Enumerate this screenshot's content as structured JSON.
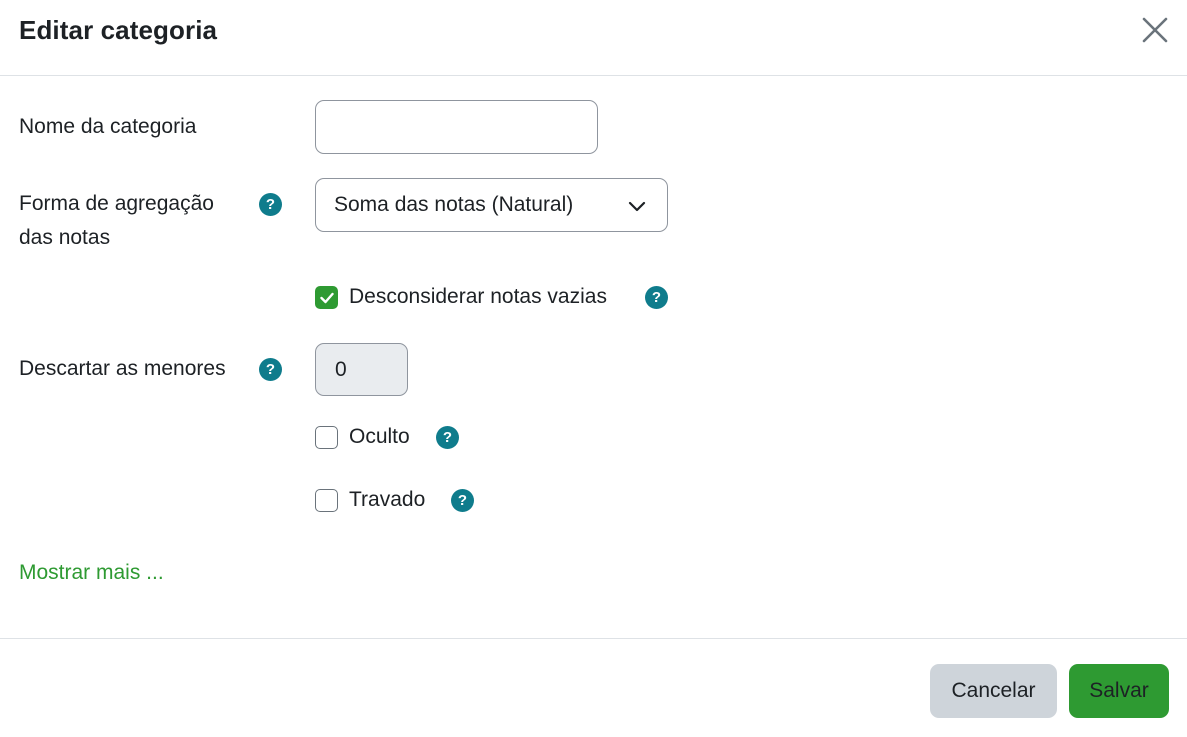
{
  "modal": {
    "title": "Editar categoria",
    "close_label": "close-icon"
  },
  "form": {
    "category_name": {
      "label": "Nome da categoria",
      "value": "",
      "placeholder": ""
    },
    "aggregation": {
      "label_line1": "Forma de agregação",
      "label_line2": "das notas",
      "selected": "Soma das notas (Natural)",
      "help_icon": "?"
    },
    "ignore_empty": {
      "label": "Desconsiderar notas vazias",
      "checked": true,
      "help_icon": "?"
    },
    "drop_lowest": {
      "label": "Descartar as menores",
      "value": "0",
      "help_icon": "?"
    },
    "hidden": {
      "label": "Oculto",
      "checked": false,
      "help_icon": "?"
    },
    "locked": {
      "label": "Travado",
      "checked": false,
      "help_icon": "?"
    },
    "show_more": "Mostrar mais ..."
  },
  "footer": {
    "cancel_label": "Cancelar",
    "save_label": "Salvar"
  },
  "colors": {
    "accent_green": "#2e9a32",
    "help_teal": "#0f7c8c",
    "border": "#8f959e",
    "cancel_bg": "#ced4da"
  }
}
